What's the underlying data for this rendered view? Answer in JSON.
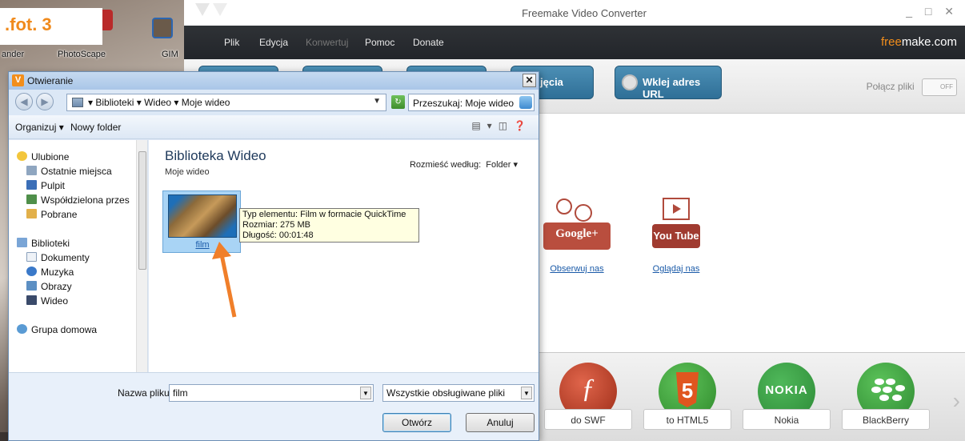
{
  "annotation": {
    "label": ".fot. 3"
  },
  "desktop": {
    "icon_labels": [
      "ander",
      "PhotoScape",
      "GIM"
    ]
  },
  "app": {
    "title": "Freemake Video Converter",
    "window_controls": "_ □ ✕",
    "menu": [
      "Plik",
      "Edycja",
      "Konwertuj",
      "Pomoc",
      "Donate"
    ],
    "menu_disabled": "Konwertuj",
    "brand": {
      "accent": "free",
      "rest": "make.com"
    },
    "toolbar": {
      "buttons": [
        "",
        "",
        "",
        "jęcia",
        "Wklej adres URL"
      ],
      "merge_label": "Połącz pliki",
      "merge_toggle": "OFF"
    },
    "social": [
      {
        "icon": "Google+",
        "link": "Obserwuj nas"
      },
      {
        "icon": "You Tube",
        "link": "Oglądaj nas"
      }
    ],
    "presets": [
      {
        "label": "do SWF",
        "icon": "flash-icon",
        "color": "#b8341c"
      },
      {
        "label": "to HTML5",
        "icon": "html5-icon",
        "color": "#e0561f"
      },
      {
        "label": "Nokia",
        "icon": "nokia-icon",
        "color": "#1f4e9a"
      },
      {
        "label": "BlackBerry",
        "icon": "blackberry-icon",
        "color": "#35a23c"
      }
    ],
    "next_glyph": "›"
  },
  "dialog": {
    "title": "Otwieranie",
    "close": "✕",
    "breadcrumb": "▾ Biblioteki ▾ Wideo ▾ Moje wideo",
    "search_placeholder": "Przeszukaj: Moje wideo",
    "organize": "Organizuj ▾",
    "new_folder": "Nowy folder",
    "nav": {
      "favorites_header": "Ulubione",
      "favorites": [
        "Ostatnie miejsca",
        "Pulpit",
        "Współdzielona przes",
        "Pobrane"
      ],
      "libraries_header": "Biblioteki",
      "libraries": [
        "Dokumenty",
        "Muzyka",
        "Obrazy",
        "Wideo"
      ],
      "homegroup": "Grupa domowa"
    },
    "library": {
      "title": "Biblioteka Wideo",
      "subtitle": "Moje wideo",
      "arrange_label": "Rozmieść według:",
      "arrange_value": "Folder ▾"
    },
    "file": {
      "name": "film",
      "tooltip_type": "Typ elementu: Film w formacie QuickTime",
      "tooltip_size": "Rozmiar: 275 MB",
      "tooltip_duration": "Długość: 00:01:48"
    },
    "footer": {
      "filename_label": "Nazwa pliku:",
      "filename_value": "film",
      "filetype_value": "Wszystkie obsługiwane pliki",
      "open_label": "Otwórz",
      "cancel_label": "Anuluj"
    }
  },
  "colors": {
    "arrow": "#f07f2a",
    "accent": "#f28e1c",
    "link": "#1a5aa8"
  }
}
